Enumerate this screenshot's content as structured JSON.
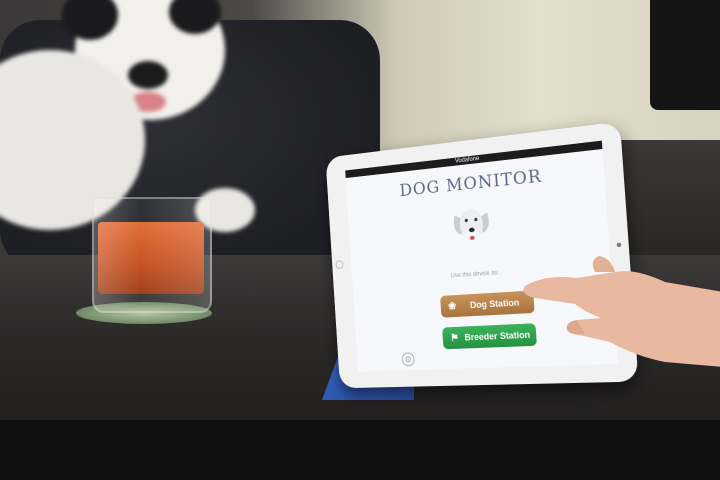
{
  "scene": {
    "description_items": [
      "dog",
      "candle",
      "tablet",
      "hand"
    ]
  },
  "app": {
    "status_bar": "Vodafone",
    "title": "DOG MONITOR",
    "subtitle": "Use this device as:",
    "buttons": [
      {
        "label": "Dog Station",
        "icon": "paw-icon",
        "color": "#b8844c"
      },
      {
        "label": "Breeder Station",
        "icon": "person-icon",
        "color": "#2fa24e"
      }
    ],
    "settings_icon": "gear-icon"
  },
  "colors": {
    "cover": "#2f5fc0",
    "candle_wax": "#d4561f",
    "app_title": "#5a6a83"
  }
}
